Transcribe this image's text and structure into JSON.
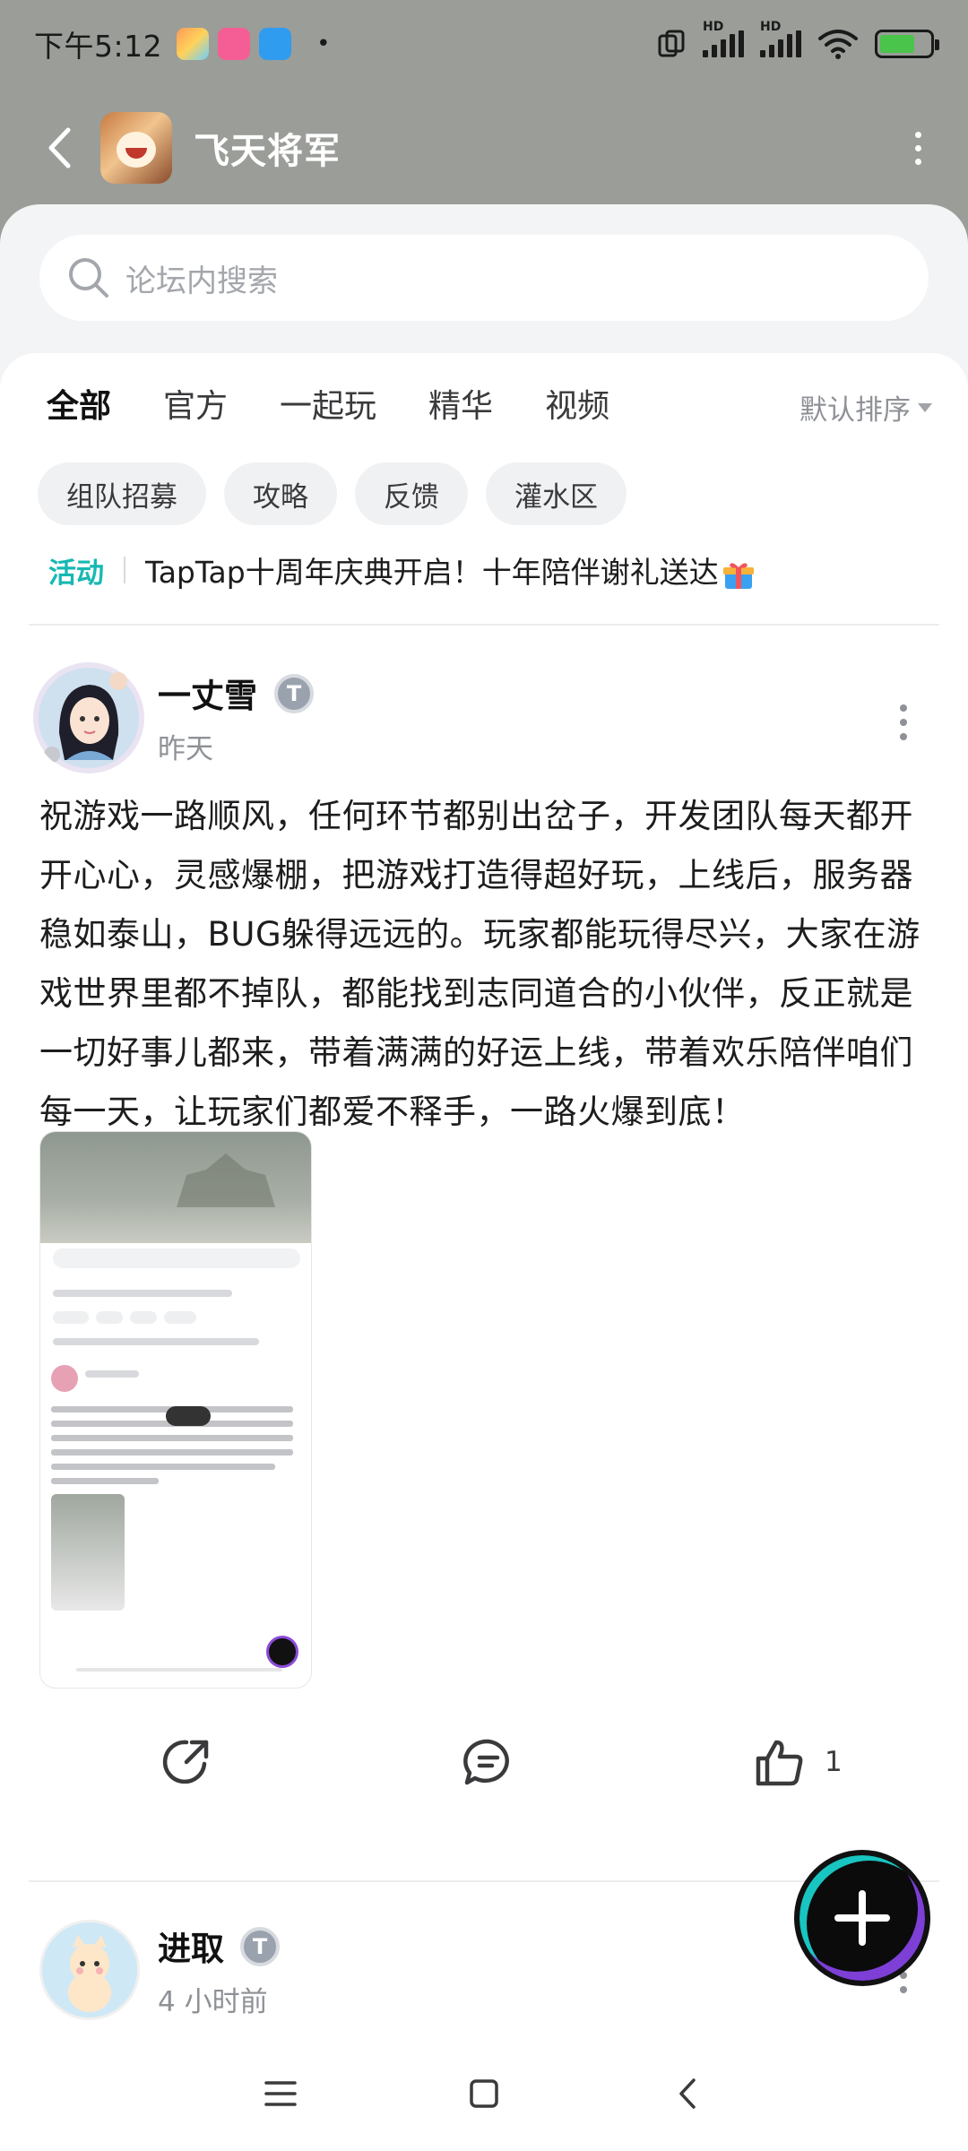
{
  "status_bar": {
    "time": "下午5:12",
    "network_label_1": "HD",
    "network_label_2": "HD"
  },
  "header": {
    "title": "飞天将军"
  },
  "search": {
    "placeholder": "论坛内搜索"
  },
  "tabs": [
    {
      "label": "全部",
      "active": true
    },
    {
      "label": "官方"
    },
    {
      "label": "一起玩"
    },
    {
      "label": "精华"
    },
    {
      "label": "视频"
    }
  ],
  "sort": {
    "label": "默认排序"
  },
  "chips": [
    "组队招募",
    "攻略",
    "反馈",
    "灌水区"
  ],
  "announcement": {
    "tag": "活动",
    "text": "TapTap十周年庆典开启！十年陪伴谢礼送达"
  },
  "posts": [
    {
      "username": "一丈雪",
      "time": "昨天",
      "body": "祝游戏一路顺风，任何环节都别出岔子，开发团队每天都开开心心，灵感爆棚，把游戏打造得超好玩，上线后，服务器稳如泰山，BUG躲得远远的。玩家都能玩得尽兴，大家在游戏世界里都不掉队，都能找到志同道合的小伙伴，反正就是一切好事儿都来，带着满满的好运上线，带着欢乐陪伴咱们每一天，让玩家们都爱不释手，一路火爆到底！",
      "like_count": "1"
    },
    {
      "username": "进取",
      "time": "4 小时前"
    }
  ],
  "colors": {
    "accent": "#19c5c0",
    "header_bg": "#9a9d98",
    "announce_tag": "#17b8b2"
  },
  "icons": [
    "back-arrow-icon",
    "more-vertical-icon",
    "search-icon",
    "share-icon",
    "comment-icon",
    "thumbs-up-icon",
    "plus-icon",
    "gift-icon",
    "verified-badge-icon",
    "menu-icon",
    "home-square-icon",
    "back-nav-icon"
  ]
}
